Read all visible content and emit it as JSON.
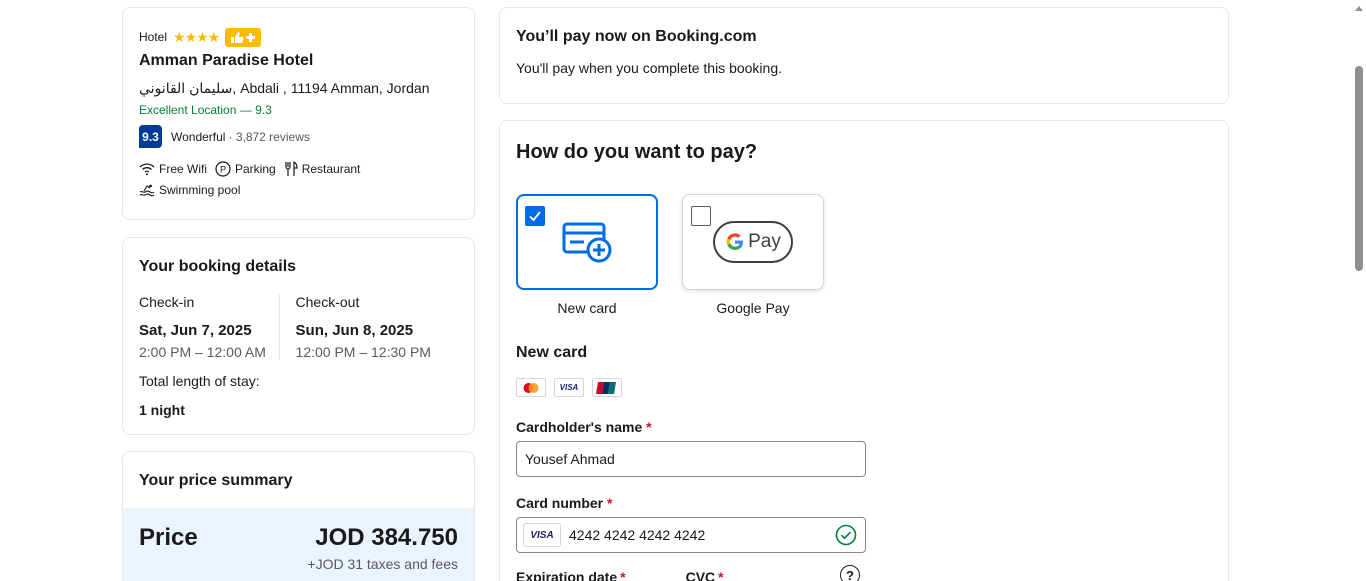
{
  "hotel": {
    "type": "Hotel",
    "stars": "★★★★",
    "badge_icon": "thumbs-up-plus-icon",
    "name": "Amman Paradise Hotel",
    "address": "سليمان القانوني, Abdali , 11194 Amman, Jordan",
    "location_score": "Excellent Location — 9.3",
    "review_score": "9.3",
    "review_word": "Wonderful",
    "review_count": "· 3,872 reviews",
    "amenities": [
      {
        "icon": "wifi-icon",
        "label": "Free Wifi"
      },
      {
        "icon": "parking-icon",
        "label": "Parking"
      },
      {
        "icon": "restaurant-icon",
        "label": "Restaurant"
      },
      {
        "icon": "swimming-pool-icon",
        "label": "Swimming pool"
      }
    ]
  },
  "booking": {
    "title": "Your booking details",
    "checkin_label": "Check-in",
    "checkin_date": "Sat, Jun 7, 2025",
    "checkin_time": "2:00 PM – 12:00 AM",
    "checkout_label": "Check-out",
    "checkout_date": "Sun, Jun 8, 2025",
    "checkout_time": "12:00 PM – 12:30 PM",
    "stay_label": "Total length of stay:",
    "stay_value": "1 night"
  },
  "price": {
    "title": "Your price summary",
    "label": "Price",
    "value": "JOD 384.750",
    "taxes": "+JOD 31 taxes and fees"
  },
  "pay_now": {
    "title": "You’ll pay now on Booking.com",
    "text": "You'll pay when you complete this booking."
  },
  "payment": {
    "title": "How do you want to pay?",
    "methods": [
      {
        "label": "New card",
        "selected": true
      },
      {
        "label": "Google Pay",
        "selected": false
      }
    ],
    "gpay_text": "Pay",
    "new_card_title": "New card",
    "card_logos": [
      "mastercard",
      "VISA",
      "unionpay"
    ],
    "cardholder_label": "Cardholder's name",
    "cardholder_value": "Yousef Ahmad",
    "card_number_label": "Card number",
    "card_number_value": "4242 4242 4242 4242",
    "card_brand": "VISA",
    "expiry_label": "Expiration date",
    "cvc_label": "CVC",
    "required_mark": "*"
  },
  "colors": {
    "brand_blue": "#006ce4",
    "score_blue": "#003b95",
    "star_yellow": "#febb02",
    "success_green": "#008234",
    "price_band": "#ebf3ff"
  }
}
